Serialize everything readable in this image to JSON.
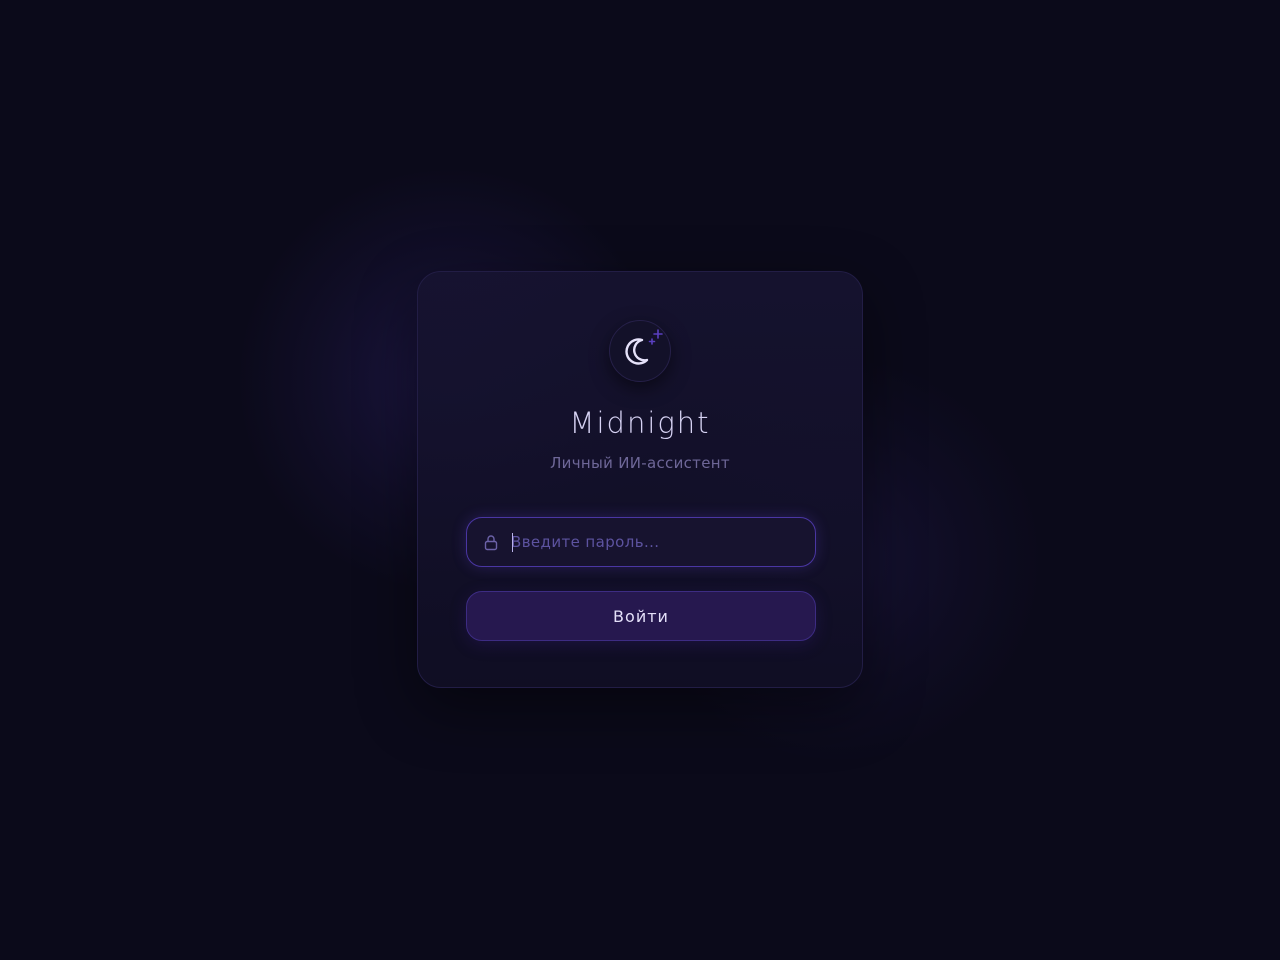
{
  "app": {
    "title": "Midnight",
    "subtitle": "Личный ИИ-ассистент",
    "logo_icon": "moon-icon",
    "sparkle_icon": "sparkle-icon"
  },
  "login": {
    "password_placeholder": "Введите пароль...",
    "password_value": "",
    "lock_icon": "lock-icon",
    "submit_label": "Войти"
  },
  "colors": {
    "background": "#0b0a1a",
    "card": "#141230",
    "accent": "#4a36a3",
    "button": "#26184f",
    "title_text": "#d6d2f3",
    "subtitle_text": "#6e6798"
  }
}
